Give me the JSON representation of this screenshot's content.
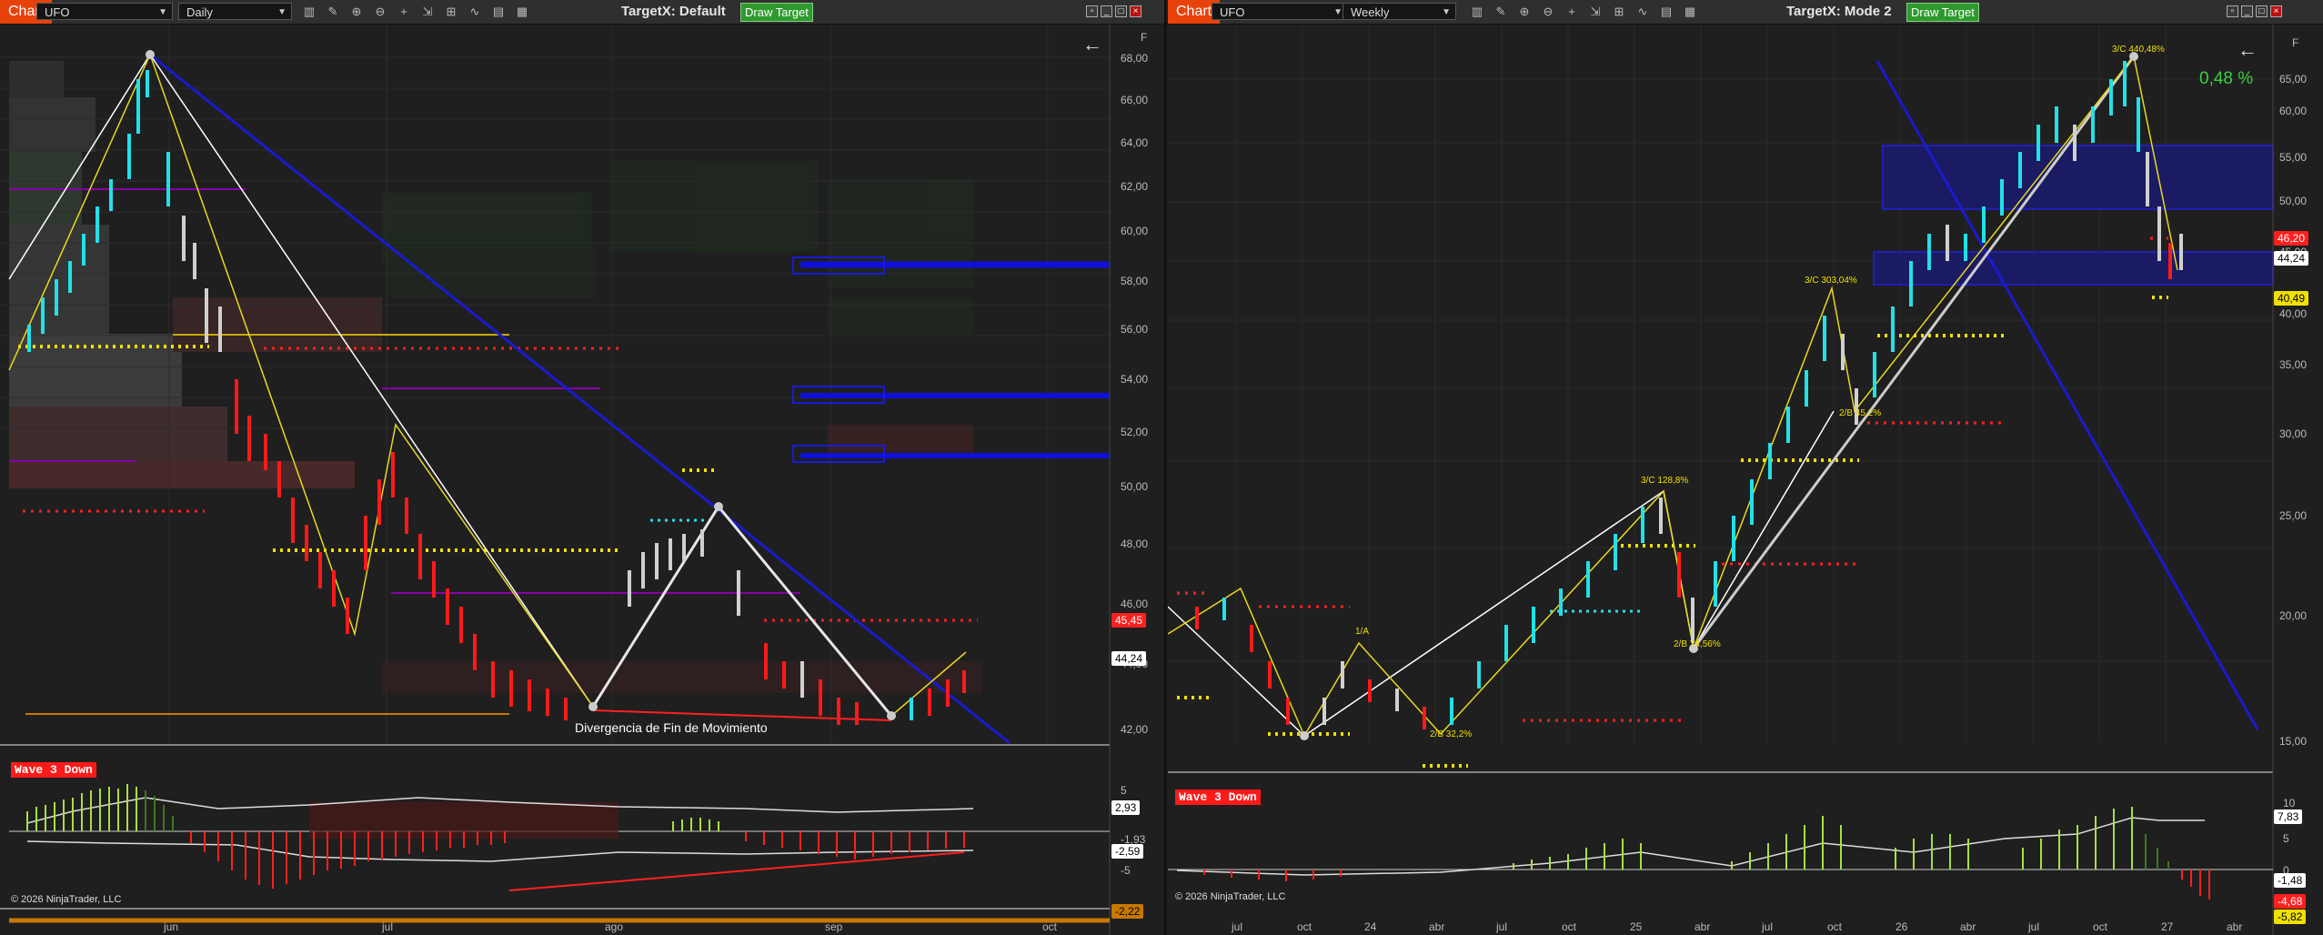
{
  "left": {
    "tab": "Chart",
    "instrument": "UFO",
    "period": "Daily",
    "title": "TargetX: Default",
    "draw_target": "Draw Target",
    "y_labels": [
      "68,00",
      "66,00",
      "64,00",
      "62,00",
      "60,00",
      "58,00",
      "56,00",
      "54,00",
      "52,00",
      "50,00",
      "48,00",
      "46,00",
      "44,00",
      "42,00"
    ],
    "price_tag_red": "45,45",
    "price_tag_white": "44,24",
    "annotation": "Divergencia de Fin de Movimiento",
    "wave_label": "Wave 3 Down",
    "osc_labels": [
      "5",
      "2,93",
      "-1,93",
      "-2,59",
      "-5"
    ],
    "osc_bottom_tag": "-2,22",
    "copyright": "© 2026 NinjaTrader, LLC",
    "x_labels": [
      "jun",
      "jul",
      "ago",
      "sep",
      "oct"
    ],
    "f_label": "F"
  },
  "right": {
    "tab": "Chart",
    "instrument": "UFO",
    "period": "Weekly",
    "title": "TargetX: Mode 2",
    "draw_target": "Draw Target",
    "y_labels": [
      "65,00",
      "60,00",
      "55,00",
      "50,00",
      "45,00",
      "40,00",
      "35,00",
      "30,00",
      "25,00",
      "20,00",
      "15,00"
    ],
    "price_tag_red": "46,20",
    "price_tag_white": "44,24",
    "price_tag_yellow": "40,49",
    "percent": "0,48 %",
    "wave_labels_on_chart": [
      "3/C 440,48%",
      "3/C 303,04%",
      "2/B 45,2%",
      "3/C 128,8%",
      "2/B 74,56%",
      "1/A",
      "2/B 32,2%"
    ],
    "wave_label": "Wave 3 Down",
    "osc_labels": [
      "10",
      "7,83",
      "5",
      "0",
      "-1,48",
      "-4,68"
    ],
    "osc_bottom_tag": "-5,82",
    "copyright": "© 2026 NinjaTrader, LLC",
    "x_labels": [
      "jul",
      "oct",
      "24",
      "abr",
      "jul",
      "oct",
      "25",
      "abr",
      "jul",
      "oct",
      "26",
      "abr",
      "jul",
      "oct",
      "27",
      "abr"
    ],
    "f_label": "F"
  },
  "colors": {
    "tab": "#e8420c",
    "up_candle": "#22e0e8",
    "down_candle": "#ff1a1a",
    "blue_line": "#1a1ad0",
    "zigzag": "#e8d820",
    "green_pct": "#3bd13b"
  }
}
